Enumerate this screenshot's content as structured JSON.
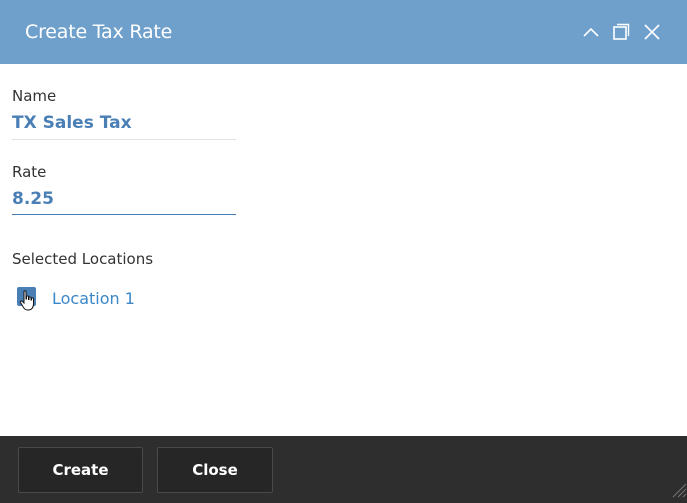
{
  "dialog": {
    "title": "Create Tax Rate"
  },
  "form": {
    "name_label": "Name",
    "name_value": "TX Sales Tax",
    "rate_label": "Rate",
    "rate_value": "8.25",
    "locations_label": "Selected Locations",
    "locations": [
      {
        "label": "Location 1",
        "checked": true
      }
    ]
  },
  "footer": {
    "create_label": "Create",
    "close_label": "Close"
  },
  "icons": {
    "collapse": "chevron-up-icon",
    "maximize": "maximize-icon",
    "close": "close-icon",
    "cursor": "hand-pointer-icon"
  },
  "colors": {
    "titlebar": "#6fa0cc",
    "accent": "#4a7fb5",
    "link": "#3a87c8",
    "footer": "#2e2e2e"
  }
}
